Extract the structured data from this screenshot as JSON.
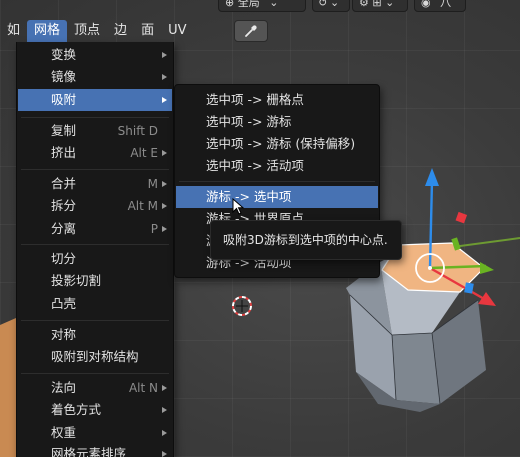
{
  "header": {
    "pivot_select": "全局",
    "snap_icon": "snap-magnet-icon",
    "proportional_icon": "proportional-editing-icon",
    "overlay_label": "八"
  },
  "menubar": {
    "items": [
      {
        "label": "如",
        "active": false
      },
      {
        "label": "网格",
        "active": true
      },
      {
        "label": "顶点",
        "active": false
      },
      {
        "label": "边",
        "active": false
      },
      {
        "label": "面",
        "active": false
      },
      {
        "label": "UV",
        "active": false
      }
    ]
  },
  "mesh_menu": {
    "items": [
      {
        "label": "变换",
        "shortcut": "",
        "submenu": true
      },
      {
        "label": "镜像",
        "shortcut": "",
        "submenu": true
      },
      {
        "label": "吸附",
        "shortcut": "",
        "submenu": true,
        "highlighted": true
      },
      {
        "label": "复制",
        "shortcut": "Shift D",
        "submenu": false
      },
      {
        "label": "挤出",
        "shortcut": "Alt E",
        "submenu": true
      },
      {
        "label": "合并",
        "shortcut": "M",
        "submenu": true
      },
      {
        "label": "拆分",
        "shortcut": "Alt M",
        "submenu": true
      },
      {
        "label": "分离",
        "shortcut": "P",
        "submenu": true
      },
      {
        "label": "切分",
        "shortcut": "",
        "submenu": false
      },
      {
        "label": "投影切割",
        "shortcut": "",
        "submenu": false
      },
      {
        "label": "凸壳",
        "shortcut": "",
        "submenu": false
      },
      {
        "label": "对称",
        "shortcut": "",
        "submenu": false
      },
      {
        "label": "吸附到对称结构",
        "shortcut": "",
        "submenu": false
      },
      {
        "label": "法向",
        "shortcut": "Alt N",
        "submenu": true
      },
      {
        "label": "着色方式",
        "shortcut": "",
        "submenu": true
      },
      {
        "label": "权重",
        "shortcut": "",
        "submenu": true
      },
      {
        "label": "网格元素排序",
        "shortcut": "",
        "submenu": true
      }
    ]
  },
  "snap_menu": {
    "items": [
      {
        "label": "选中项 -> 栅格点"
      },
      {
        "label": "选中项 -> 游标"
      },
      {
        "label": "选中项 -> 游标 (保持偏移)"
      },
      {
        "label": "选中项 -> 活动项"
      },
      {
        "label": "游标 -> 选中项",
        "highlighted": true
      },
      {
        "label": "游标 -> 世界原点"
      },
      {
        "label": "游标 -> 栅格点"
      },
      {
        "label": "游标 -> 活动项"
      }
    ]
  },
  "tooltip": {
    "text": "吸附3D游标到选中项的中心点."
  },
  "colors": {
    "highlight": "#4772b3",
    "menu_bg": "#181818",
    "gizmo_x": "#e8373f",
    "gizmo_y": "#6ab322",
    "gizmo_z": "#2d8ceb",
    "selected_face": "#f0a766"
  },
  "icons": [
    "eyedropper-icon",
    "submenu-arrow-icon",
    "3d-cursor-icon",
    "transform-gizmo-icon",
    "mouse-pointer-icon"
  ]
}
